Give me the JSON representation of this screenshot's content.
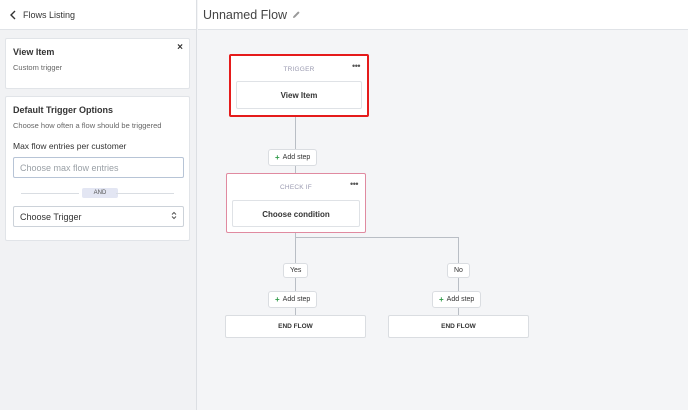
{
  "sidebar": {
    "back_label": "Flows Listing",
    "item": {
      "name": "View Item",
      "subtitle": "Custom trigger",
      "close": "×"
    },
    "options": {
      "title": "Default Trigger Options",
      "description": "Choose how often a flow should be triggered",
      "max_entries_label": "Max flow entries per customer",
      "max_entries_placeholder": "Choose max flow entries",
      "and_label": "AND",
      "trigger_select_value": "Choose Trigger",
      "select_arrows": "⌃⌄"
    }
  },
  "canvas": {
    "flow_name": "Unnamed Flow",
    "trigger_block": {
      "heading": "TRIGGER",
      "more": "•••",
      "card_label": "View Item"
    },
    "add_step_label": "Add step",
    "check_block": {
      "heading": "CHECK IF",
      "more": "•••",
      "card_label": "Choose condition"
    },
    "branches": {
      "yes": "Yes",
      "no": "No"
    },
    "end_flow_label": "END FLOW"
  },
  "colors": {
    "highlight": "#e51b1b",
    "plus": "#2e9a47",
    "check_border": "#e08aa0"
  }
}
